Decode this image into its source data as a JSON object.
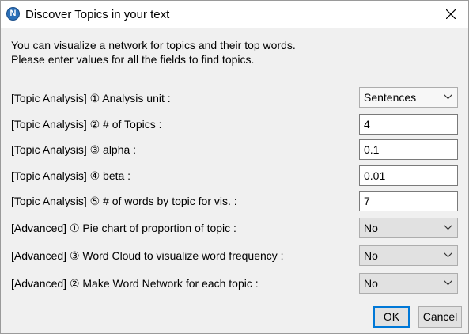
{
  "window": {
    "title": "Discover Topics in your text",
    "app_icon_letter": "N"
  },
  "intro": {
    "line1": "You can visualize a network for topics and their top words.",
    "line2": "Please enter values for all the fields to find topics."
  },
  "fields": [
    {
      "label": "[Topic Analysis] ① Analysis unit :",
      "type": "select",
      "value": "Sentences"
    },
    {
      "label": "[Topic Analysis] ② # of Topics :",
      "type": "text",
      "value": "4"
    },
    {
      "label": "[Topic Analysis] ③ alpha :",
      "type": "text",
      "value": "0.1"
    },
    {
      "label": "[Topic Analysis] ④ beta :",
      "type": "text",
      "value": "0.01"
    },
    {
      "label": "[Topic Analysis] ⑤ # of words by topic for vis. :",
      "type": "text",
      "value": "7"
    },
    {
      "label": "[Advanced] ① Pie chart of proportion of topic  :",
      "type": "select",
      "value": "No"
    },
    {
      "label": "[Advanced] ③ Word Cloud to visualize word frequency :",
      "type": "select",
      "value": "No"
    },
    {
      "label": "[Advanced] ② Make Word Network for each topic :",
      "type": "select",
      "value": "No"
    }
  ],
  "buttons": {
    "ok": "OK",
    "cancel": "Cancel"
  },
  "icons": {
    "app": "app-logo-icon",
    "close": "close-icon",
    "dropdown": "chevron-down-icon"
  },
  "colors": {
    "focus_border": "#0078d7",
    "app_icon": "#2a6fb8"
  }
}
